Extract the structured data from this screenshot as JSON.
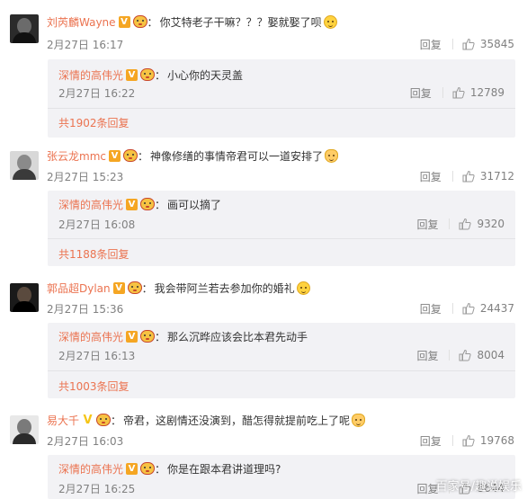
{
  "reply_label": "回复",
  "watermark": "百家号/趣说娱乐",
  "threads": [
    {
      "user": "刘芮麟Wayne",
      "text": "你艾特老子干嘛？？？娶就娶了呗",
      "time": "2月27日 16:17",
      "likes": "35845",
      "sub": {
        "user": "深情的高伟光",
        "text": "小心你的天灵盖",
        "time": "2月27日 16:22",
        "likes": "12789",
        "more": "共1902条回复"
      }
    },
    {
      "user": "张云龙mmc",
      "text": "神像修缮的事情帝君可以一道安排了",
      "time": "2月27日 15:23",
      "likes": "31712",
      "sub": {
        "user": "深情的高伟光",
        "text": "画可以摘了",
        "time": "2月27日 16:08",
        "likes": "9320",
        "more": "共1188条回复"
      }
    },
    {
      "user": "郭品超Dylan",
      "text": "我会带阿兰若去参加你的婚礼",
      "time": "2月27日 15:36",
      "likes": "24437",
      "sub": {
        "user": "深情的高伟光",
        "text": "那么沉晔应该会比本君先动手",
        "time": "2月27日 16:13",
        "likes": "8004",
        "more": "共1003条回复"
      }
    },
    {
      "user": "易大千",
      "text": "帝君，这剧情还没演到，醋怎得就提前吃上了呢",
      "time": "2月27日 16:03",
      "likes": "19768",
      "sub": {
        "user": "深情的高伟光",
        "text": "你是在跟本君讲道理吗?",
        "time": "2月27日 16:25",
        "likes": "8644",
        "more": ""
      }
    }
  ]
}
